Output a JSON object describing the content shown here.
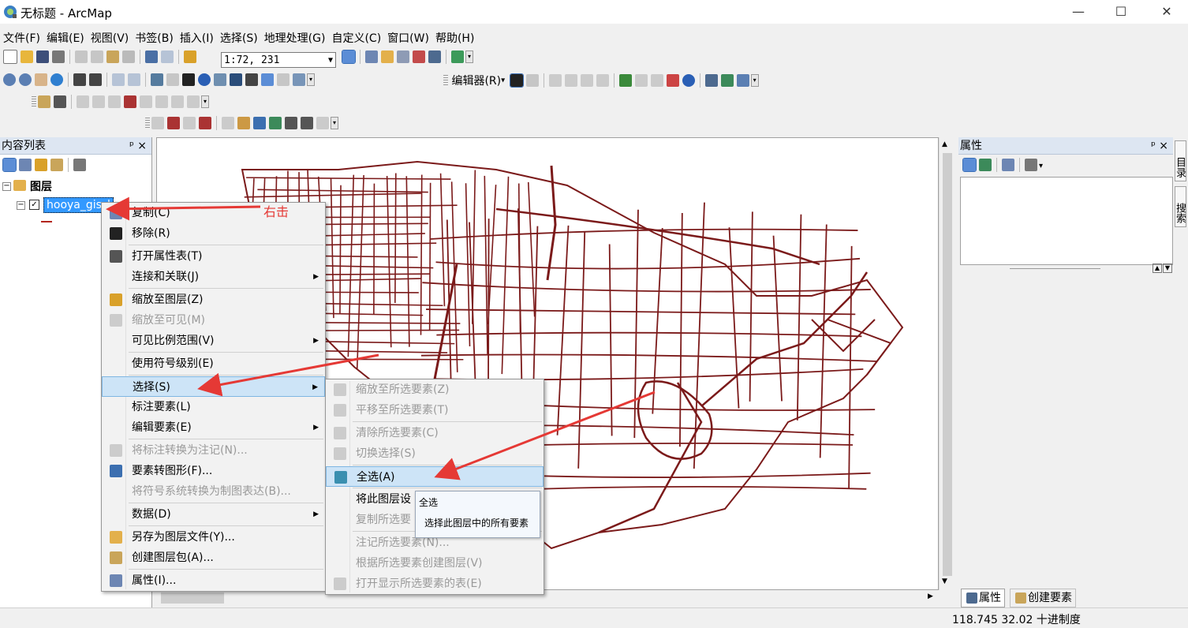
{
  "window": {
    "title": "无标题 - ArcMap",
    "minimize_glyph": "—",
    "maximize_glyph": "☐",
    "close_glyph": "✕"
  },
  "menubar": [
    "文件(F)",
    "编辑(E)",
    "视图(V)",
    "书签(B)",
    "插入(I)",
    "选择(S)",
    "地理处理(G)",
    "自定义(C)",
    "窗口(W)",
    "帮助(H)"
  ],
  "toolbar": {
    "scale_value": "1:72, 231",
    "editor_label": "编辑器(R)"
  },
  "toc": {
    "title": "内容列表",
    "pin_glyph": "ᵖ",
    "close_glyph": "×",
    "root_label": "图层",
    "layer_name": "hooya_gis_l"
  },
  "annotation": {
    "right_click_label": "右击",
    "color": "#e53935"
  },
  "context_menu": [
    {
      "label": "复制(C)",
      "icon": "copy-icon",
      "disabled": false
    },
    {
      "label": "移除(R)",
      "icon": "remove-icon",
      "disabled": false
    },
    {
      "label": "打开属性表(T)",
      "icon": "table-icon",
      "disabled": false
    },
    {
      "label": "连接和关联(J)",
      "icon": "",
      "disabled": false,
      "submenu": true
    },
    {
      "label": "缩放至图层(Z)",
      "icon": "zoom-layer-icon",
      "disabled": false
    },
    {
      "label": "缩放至可见(M)",
      "icon": "zoom-visible-icon",
      "disabled": true
    },
    {
      "label": "可见比例范围(V)",
      "icon": "",
      "disabled": false,
      "submenu": true
    },
    {
      "label": "使用符号级别(E)",
      "icon": "",
      "disabled": false
    },
    {
      "label": "选择(S)",
      "icon": "",
      "disabled": false,
      "submenu": true,
      "highlighted": true
    },
    {
      "label": "标注要素(L)",
      "icon": "",
      "disabled": false
    },
    {
      "label": "编辑要素(E)",
      "icon": "",
      "disabled": false,
      "submenu": true
    },
    {
      "label": "将标注转换为注记(N)...",
      "icon": "convert-labels-icon",
      "disabled": true
    },
    {
      "label": "要素转图形(F)...",
      "icon": "features-graphics-icon",
      "disabled": false
    },
    {
      "label": "将符号系统转换为制图表达(B)...",
      "icon": "",
      "disabled": true
    },
    {
      "label": "数据(D)",
      "icon": "",
      "disabled": false,
      "submenu": true
    },
    {
      "label": "另存为图层文件(Y)...",
      "icon": "layer-file-icon",
      "disabled": false
    },
    {
      "label": "创建图层包(A)...",
      "icon": "layer-package-icon",
      "disabled": false
    },
    {
      "label": "属性(I)...",
      "icon": "properties-icon",
      "disabled": false
    }
  ],
  "submenu": [
    {
      "label": "缩放至所选要素(Z)",
      "disabled": true
    },
    {
      "label": "平移至所选要素(T)",
      "disabled": true
    },
    {
      "label": "清除所选要素(C)",
      "disabled": true
    },
    {
      "label": "切换选择(S)",
      "disabled": true
    },
    {
      "label": "全选(A)",
      "disabled": false,
      "highlighted": true
    },
    {
      "label": "将此图层设",
      "disabled": false
    },
    {
      "label": "复制所选要",
      "disabled": true
    },
    {
      "label": "注记所选要素(N)...",
      "disabled": true
    },
    {
      "label": "根据所选要素创建图层(V)",
      "disabled": true
    },
    {
      "label": "打开显示所选要素的表(E)",
      "disabled": true
    }
  ],
  "tooltip": {
    "title": "全选",
    "description": "选择此图层中的所有要素"
  },
  "attributes": {
    "title": "属性",
    "pin_glyph": "ᵖ",
    "close_glyph": "×",
    "bottom_tab_1": "属性",
    "bottom_tab_2": "创建要素"
  },
  "side_tabs": [
    "目录",
    "搜索"
  ],
  "statusbar": {
    "coordinates": "118.745  32.02 十进制度"
  },
  "colors": {
    "road": "#7b1a1a",
    "selection": "#3399ff"
  }
}
